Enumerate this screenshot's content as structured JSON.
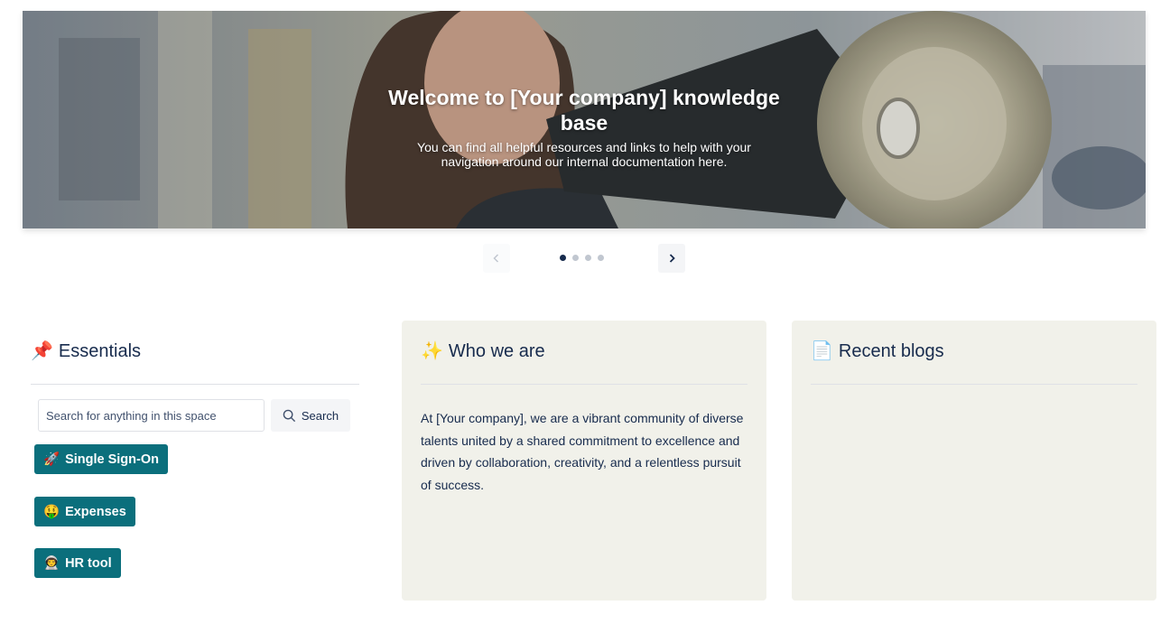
{
  "hero": {
    "title": "Welcome to [Your company] knowledge base",
    "subtitle": "You can find all helpful resources and links to help with your navigation around our internal documentation here."
  },
  "carousel": {
    "prev_icon": "chevron-left-icon",
    "next_icon": "chevron-right-icon",
    "slide_count": 4,
    "active_slide": 1
  },
  "essentials": {
    "emoji": "📌",
    "title": "Essentials",
    "search": {
      "placeholder": "Search for anything in this space",
      "value": "",
      "button_label": "Search",
      "icon": "search-icon"
    },
    "links": [
      {
        "emoji": "🚀",
        "label": "Single Sign-On"
      },
      {
        "emoji": "🤑",
        "label": "Expenses"
      },
      {
        "emoji": "👨‍🚀",
        "label": "HR tool"
      }
    ]
  },
  "who_we_are": {
    "emoji": "✨",
    "title": "Who we are",
    "body": "At [Your company], we are a vibrant community of diverse talents united by a shared commitment to excellence and driven by collaboration, creativity, and a relentless pursuit of success."
  },
  "recent_blogs": {
    "emoji": "📄",
    "title": "Recent blogs"
  },
  "colors": {
    "accent_button": "#0b6f7c",
    "panel_bg": "#f1f1ea",
    "text": "#172b4d"
  }
}
